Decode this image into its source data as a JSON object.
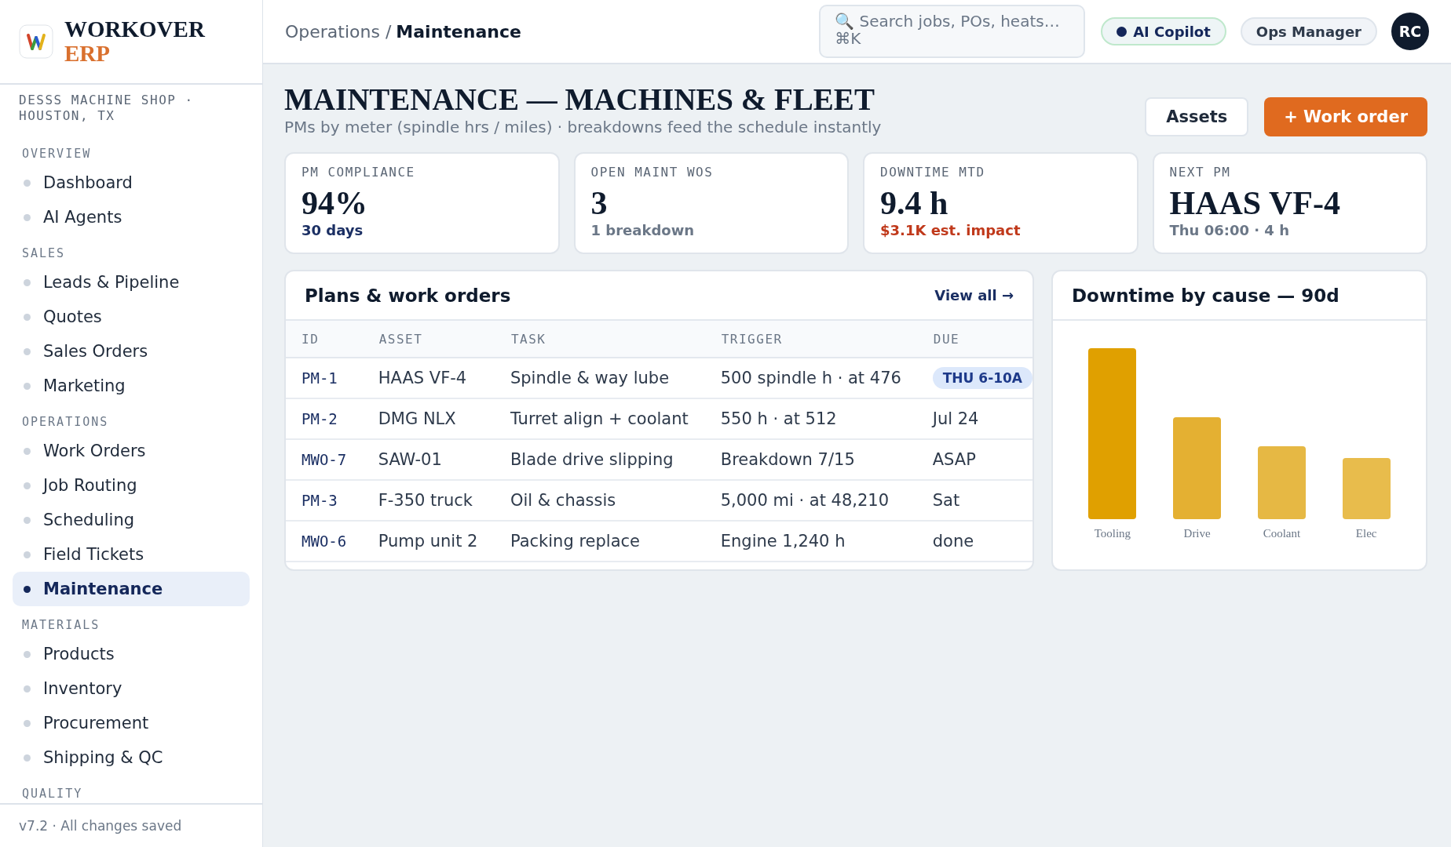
{
  "brand": {
    "name": "WORKOVER",
    "suffix": "ERP"
  },
  "sidebar": {
    "org": "DESSS MACHINE SHOP · HOUSTON, TX",
    "sections": [
      {
        "title": "OVERVIEW",
        "items": [
          {
            "label": "Dashboard",
            "selected": false
          },
          {
            "label": "AI Agents",
            "selected": false
          }
        ]
      },
      {
        "title": "SALES",
        "items": [
          {
            "label": "Leads & Pipeline",
            "selected": false
          },
          {
            "label": "Quotes",
            "selected": false
          },
          {
            "label": "Sales Orders",
            "selected": false
          },
          {
            "label": "Marketing",
            "selected": false
          }
        ]
      },
      {
        "title": "OPERATIONS",
        "items": [
          {
            "label": "Work Orders",
            "selected": false
          },
          {
            "label": "Job Routing",
            "selected": false
          },
          {
            "label": "Scheduling",
            "selected": false
          },
          {
            "label": "Field Tickets",
            "selected": false
          },
          {
            "label": "Maintenance",
            "selected": true
          }
        ]
      },
      {
        "title": "MATERIALS",
        "items": [
          {
            "label": "Products",
            "selected": false
          },
          {
            "label": "Inventory",
            "selected": false
          },
          {
            "label": "Procurement",
            "selected": false
          },
          {
            "label": "Shipping & QC",
            "selected": false
          }
        ]
      },
      {
        "title": "QUALITY"
      }
    ],
    "footer": "v7.2 · All changes saved"
  },
  "topbar": {
    "breadcrumb_parent": "Operations /",
    "breadcrumb_current": "Maintenance",
    "search": {
      "placeholder": "🔍 Search jobs, POs, heats… ⌘K"
    },
    "copilot": "AI Copilot",
    "role": "Ops Manager",
    "avatar": "RC"
  },
  "page": {
    "title": "MAINTENANCE — MACHINES & FLEET",
    "subtitle": "PMs by meter (spindle hrs / miles) · breakdowns feed the schedule instantly",
    "buttons": [
      {
        "label": "Assets",
        "kind": "secondary"
      },
      {
        "label": "+ Work order",
        "kind": "primary"
      }
    ]
  },
  "kpis": [
    {
      "label": "PM COMPLIANCE",
      "value": "94%",
      "note": "30 days",
      "kind": "navy"
    },
    {
      "label": "OPEN MAINT WOS",
      "value": "3",
      "note": "1 breakdown",
      "kind": "muted"
    },
    {
      "label": "DOWNTIME MTD",
      "value": "9.4 h",
      "note": "$3.1K est. impact",
      "kind": "danger"
    },
    {
      "label": "NEXT PM",
      "value": "HAAS VF-4",
      "note": "Thu 06:00 · 4 h",
      "kind": "muted"
    }
  ],
  "table": {
    "title": "Plans & work orders",
    "link": "View all →",
    "columns": [
      "ID",
      "ASSET",
      "TASK",
      "TRIGGER",
      "DUE"
    ],
    "rows": [
      {
        "id": "PM-1",
        "asset": "HAAS VF-4",
        "task": "Spindle & way lube",
        "trigger": "500 spindle h · at 476",
        "due": "THU 6-10A",
        "kind": "badge"
      },
      {
        "id": "PM-2",
        "asset": "DMG NLX",
        "task": "Turret align + coolant",
        "trigger": "550 h · at 512",
        "due": "Jul 24",
        "kind": "plain"
      },
      {
        "id": "MWO-7",
        "asset": "SAW-01",
        "task": "Blade drive slipping",
        "trigger": "Breakdown 7/15",
        "due": "ASAP",
        "kind": "plain"
      },
      {
        "id": "PM-3",
        "asset": "F-350 truck",
        "task": "Oil & chassis",
        "trigger": "5,000 mi · at 48,210",
        "due": "Sat",
        "kind": "plain"
      },
      {
        "id": "MWO-6",
        "asset": "Pump unit 2",
        "task": "Packing replace",
        "trigger": "Engine 1,240 h",
        "due": "done",
        "kind": "plain"
      }
    ]
  },
  "chart": {
    "title": "Downtime by cause — 90d",
    "bar_labels": [
      "Tooling",
      "Drive",
      "Coolant",
      "Elec"
    ]
  }
}
